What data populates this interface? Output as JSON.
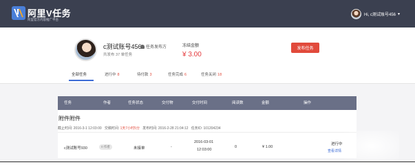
{
  "header": {
    "logo_title": "阿里V任务",
    "logo_subtitle": "阿里官方内容推广平台",
    "user_greeting": "Hi, c测试账号456",
    "menu_icon": "chevron-down-icon"
  },
  "profile": {
    "name": "c测试账号456",
    "role_badge": "任务发布方",
    "stat": "共发布 37 单任务",
    "frozen_label": "冻结金额",
    "frozen_value": "¥ 3.00",
    "publish_button": "发布任务"
  },
  "tabs": [
    {
      "label": "全部任务",
      "count": ""
    },
    {
      "label": "进行中",
      "count": "8"
    },
    {
      "label": "待付款",
      "count": "3"
    },
    {
      "label": "任务完成",
      "count": "6"
    },
    {
      "label": "任务关闭",
      "count": "18"
    }
  ],
  "table": {
    "headers": [
      "任务",
      "作者",
      "任务状态",
      "交付物",
      "交付时间",
      "阅读数",
      "金额",
      "操作"
    ]
  },
  "task": {
    "title": "附件附件",
    "deadline": "截止时间: 2016-3-1 12:03:00",
    "delivery_label": "交稿时间:",
    "delivery_value": "1天7小时5分",
    "published": "发布时间: 2016-2-28 21:04:12",
    "task_id": "任务ID: 101204234",
    "row": {
      "account": "c测试账号930",
      "author_chip": "0 作者",
      "status": "未接单",
      "deliverable": "-",
      "time_date": "2016-03-01",
      "time_clock": "12:03:00",
      "reads": "0",
      "amount": "¥ 1.00",
      "op_status": "进行中",
      "op_link": "查看详情"
    }
  },
  "colors": {
    "topbar": "#3b4050",
    "accent_red": "#e14a3b",
    "table_header": "#6a7087",
    "link_blue": "#3b6bd6"
  }
}
